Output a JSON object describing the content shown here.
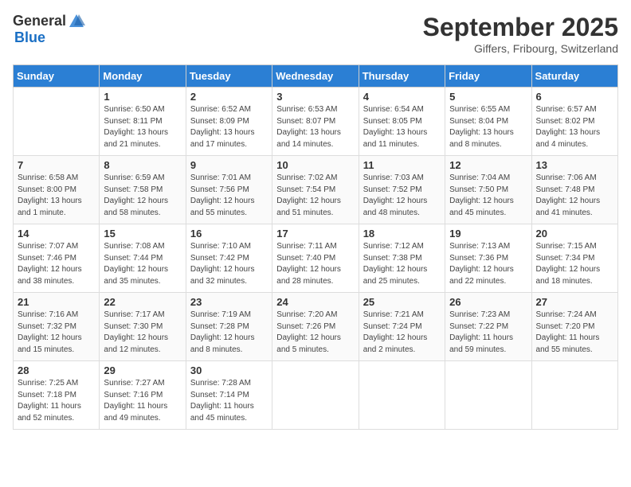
{
  "header": {
    "logo_general": "General",
    "logo_blue": "Blue",
    "month": "September 2025",
    "location": "Giffers, Fribourg, Switzerland"
  },
  "weekdays": [
    "Sunday",
    "Monday",
    "Tuesday",
    "Wednesday",
    "Thursday",
    "Friday",
    "Saturday"
  ],
  "weeks": [
    [
      {
        "day": "",
        "sunrise": "",
        "sunset": "",
        "daylight": ""
      },
      {
        "day": "1",
        "sunrise": "Sunrise: 6:50 AM",
        "sunset": "Sunset: 8:11 PM",
        "daylight": "Daylight: 13 hours and 21 minutes."
      },
      {
        "day": "2",
        "sunrise": "Sunrise: 6:52 AM",
        "sunset": "Sunset: 8:09 PM",
        "daylight": "Daylight: 13 hours and 17 minutes."
      },
      {
        "day": "3",
        "sunrise": "Sunrise: 6:53 AM",
        "sunset": "Sunset: 8:07 PM",
        "daylight": "Daylight: 13 hours and 14 minutes."
      },
      {
        "day": "4",
        "sunrise": "Sunrise: 6:54 AM",
        "sunset": "Sunset: 8:05 PM",
        "daylight": "Daylight: 13 hours and 11 minutes."
      },
      {
        "day": "5",
        "sunrise": "Sunrise: 6:55 AM",
        "sunset": "Sunset: 8:04 PM",
        "daylight": "Daylight: 13 hours and 8 minutes."
      },
      {
        "day": "6",
        "sunrise": "Sunrise: 6:57 AM",
        "sunset": "Sunset: 8:02 PM",
        "daylight": "Daylight: 13 hours and 4 minutes."
      }
    ],
    [
      {
        "day": "7",
        "sunrise": "Sunrise: 6:58 AM",
        "sunset": "Sunset: 8:00 PM",
        "daylight": "Daylight: 13 hours and 1 minute."
      },
      {
        "day": "8",
        "sunrise": "Sunrise: 6:59 AM",
        "sunset": "Sunset: 7:58 PM",
        "daylight": "Daylight: 12 hours and 58 minutes."
      },
      {
        "day": "9",
        "sunrise": "Sunrise: 7:01 AM",
        "sunset": "Sunset: 7:56 PM",
        "daylight": "Daylight: 12 hours and 55 minutes."
      },
      {
        "day": "10",
        "sunrise": "Sunrise: 7:02 AM",
        "sunset": "Sunset: 7:54 PM",
        "daylight": "Daylight: 12 hours and 51 minutes."
      },
      {
        "day": "11",
        "sunrise": "Sunrise: 7:03 AM",
        "sunset": "Sunset: 7:52 PM",
        "daylight": "Daylight: 12 hours and 48 minutes."
      },
      {
        "day": "12",
        "sunrise": "Sunrise: 7:04 AM",
        "sunset": "Sunset: 7:50 PM",
        "daylight": "Daylight: 12 hours and 45 minutes."
      },
      {
        "day": "13",
        "sunrise": "Sunrise: 7:06 AM",
        "sunset": "Sunset: 7:48 PM",
        "daylight": "Daylight: 12 hours and 41 minutes."
      }
    ],
    [
      {
        "day": "14",
        "sunrise": "Sunrise: 7:07 AM",
        "sunset": "Sunset: 7:46 PM",
        "daylight": "Daylight: 12 hours and 38 minutes."
      },
      {
        "day": "15",
        "sunrise": "Sunrise: 7:08 AM",
        "sunset": "Sunset: 7:44 PM",
        "daylight": "Daylight: 12 hours and 35 minutes."
      },
      {
        "day": "16",
        "sunrise": "Sunrise: 7:10 AM",
        "sunset": "Sunset: 7:42 PM",
        "daylight": "Daylight: 12 hours and 32 minutes."
      },
      {
        "day": "17",
        "sunrise": "Sunrise: 7:11 AM",
        "sunset": "Sunset: 7:40 PM",
        "daylight": "Daylight: 12 hours and 28 minutes."
      },
      {
        "day": "18",
        "sunrise": "Sunrise: 7:12 AM",
        "sunset": "Sunset: 7:38 PM",
        "daylight": "Daylight: 12 hours and 25 minutes."
      },
      {
        "day": "19",
        "sunrise": "Sunrise: 7:13 AM",
        "sunset": "Sunset: 7:36 PM",
        "daylight": "Daylight: 12 hours and 22 minutes."
      },
      {
        "day": "20",
        "sunrise": "Sunrise: 7:15 AM",
        "sunset": "Sunset: 7:34 PM",
        "daylight": "Daylight: 12 hours and 18 minutes."
      }
    ],
    [
      {
        "day": "21",
        "sunrise": "Sunrise: 7:16 AM",
        "sunset": "Sunset: 7:32 PM",
        "daylight": "Daylight: 12 hours and 15 minutes."
      },
      {
        "day": "22",
        "sunrise": "Sunrise: 7:17 AM",
        "sunset": "Sunset: 7:30 PM",
        "daylight": "Daylight: 12 hours and 12 minutes."
      },
      {
        "day": "23",
        "sunrise": "Sunrise: 7:19 AM",
        "sunset": "Sunset: 7:28 PM",
        "daylight": "Daylight: 12 hours and 8 minutes."
      },
      {
        "day": "24",
        "sunrise": "Sunrise: 7:20 AM",
        "sunset": "Sunset: 7:26 PM",
        "daylight": "Daylight: 12 hours and 5 minutes."
      },
      {
        "day": "25",
        "sunrise": "Sunrise: 7:21 AM",
        "sunset": "Sunset: 7:24 PM",
        "daylight": "Daylight: 12 hours and 2 minutes."
      },
      {
        "day": "26",
        "sunrise": "Sunrise: 7:23 AM",
        "sunset": "Sunset: 7:22 PM",
        "daylight": "Daylight: 11 hours and 59 minutes."
      },
      {
        "day": "27",
        "sunrise": "Sunrise: 7:24 AM",
        "sunset": "Sunset: 7:20 PM",
        "daylight": "Daylight: 11 hours and 55 minutes."
      }
    ],
    [
      {
        "day": "28",
        "sunrise": "Sunrise: 7:25 AM",
        "sunset": "Sunset: 7:18 PM",
        "daylight": "Daylight: 11 hours and 52 minutes."
      },
      {
        "day": "29",
        "sunrise": "Sunrise: 7:27 AM",
        "sunset": "Sunset: 7:16 PM",
        "daylight": "Daylight: 11 hours and 49 minutes."
      },
      {
        "day": "30",
        "sunrise": "Sunrise: 7:28 AM",
        "sunset": "Sunset: 7:14 PM",
        "daylight": "Daylight: 11 hours and 45 minutes."
      },
      {
        "day": "",
        "sunrise": "",
        "sunset": "",
        "daylight": ""
      },
      {
        "day": "",
        "sunrise": "",
        "sunset": "",
        "daylight": ""
      },
      {
        "day": "",
        "sunrise": "",
        "sunset": "",
        "daylight": ""
      },
      {
        "day": "",
        "sunrise": "",
        "sunset": "",
        "daylight": ""
      }
    ]
  ]
}
